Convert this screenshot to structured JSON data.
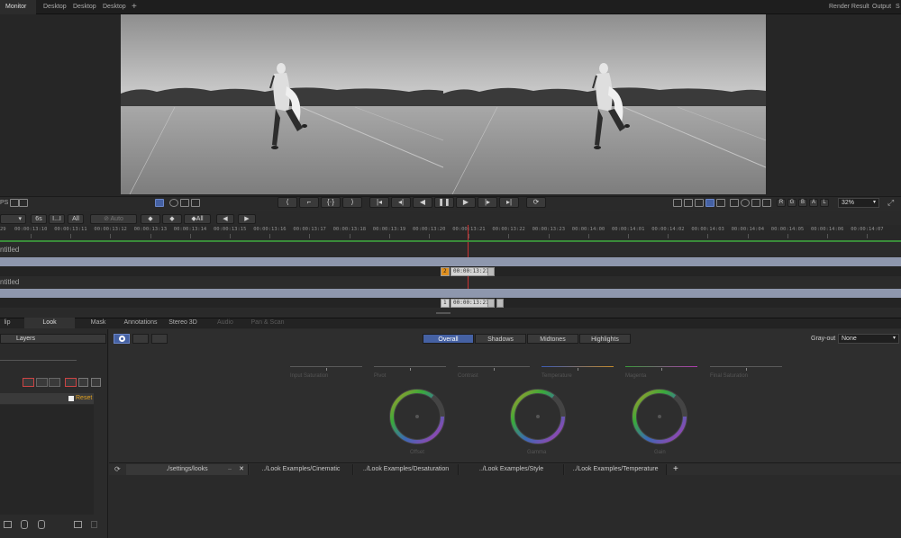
{
  "tabs": {
    "monitor": "Monitor",
    "desktop1": "Desktop",
    "desktop2": "Desktop",
    "desktop3": "Desktop",
    "add": "+",
    "render_result": "Render Result",
    "output": "Output",
    "overflow": "S"
  },
  "viewer": {
    "left_edge_label": "PS",
    "zoom_value": "32%",
    "channels": [
      "R",
      "G",
      "B",
      "A",
      "L"
    ]
  },
  "timeline": {
    "fps_label": "6s",
    "bracket_label": "I...I",
    "all_label": "All",
    "auto_label": "Auto",
    "all_keys_label": "All",
    "ticks": [
      "29",
      "00:00:13:10",
      "00:00:13:11",
      "00:00:13:12",
      "00:00:13:13",
      "00:00:13:14",
      "00:00:13:15",
      "00:00:13:16",
      "00:00:13:17",
      "00:00:13:18",
      "00:00:13:19",
      "00:00:13:20",
      "00:00:13:21",
      "00:00:13:22",
      "00:00:13:23",
      "00:00:14:00",
      "00:00:14:01",
      "00:00:14:02",
      "00:00:14:03",
      "00:00:14:04",
      "00:00:14:05",
      "00:00:14:06",
      "00:00:14:07"
    ],
    "track1_name": "ntitled",
    "track1_index": "2",
    "track1_timecode": "00:00:13:21",
    "track2_name": "ntitled",
    "track2_index": "1",
    "track2_timecode": "00:00:13:21"
  },
  "panel_tabs": {
    "clip": "lip",
    "look": "Look",
    "mask": "Mask",
    "annotations": "Annotations",
    "stereo": "Stereo 3D",
    "audio": "Audio",
    "pan_scan": "Pan & Scan"
  },
  "left_panel": {
    "layers_label": "Layers",
    "reset_label": "Reset"
  },
  "look": {
    "ranges": [
      "Overall",
      "Shadows",
      "Midtones",
      "Highlights"
    ],
    "grayout_label": "Gray-out",
    "grayout_value": "None",
    "sliders": [
      "Input Saturation",
      "Pivot",
      "Contrast",
      "Temperature",
      "Magenta",
      "Final Saturation"
    ],
    "wheels": [
      "Offset",
      "Gamma",
      "Gain"
    ]
  },
  "looks_tabs": [
    "./settings/looks",
    "../Look Examples/Cinematic",
    "../Look Examples/Desaturation",
    "../Look Examples/Style",
    "../Look Examples/Temperature"
  ],
  "looks_add": "+"
}
